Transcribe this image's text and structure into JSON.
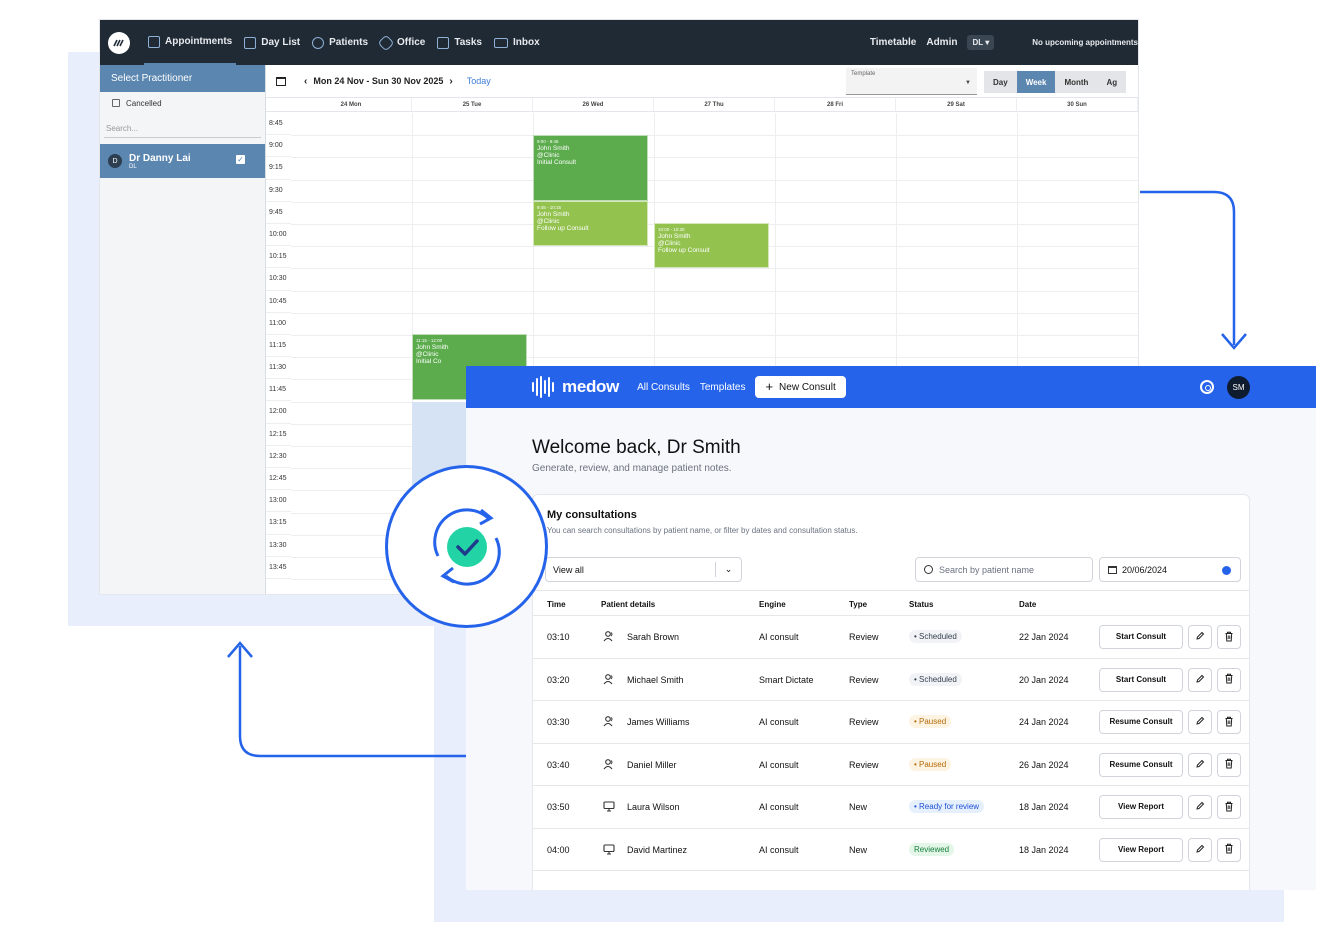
{
  "calendar": {
    "nav": [
      {
        "label": "Appointments",
        "active": true
      },
      {
        "label": "Day List"
      },
      {
        "label": "Patients"
      },
      {
        "label": "Office"
      },
      {
        "label": "Tasks"
      },
      {
        "label": "Inbox"
      }
    ],
    "top_right": {
      "timetable": "Timetable",
      "admin": "Admin",
      "user_badge": "DL ▾",
      "upcoming": "No upcoming appointments"
    },
    "sidebar": {
      "header": "Select Practitioner",
      "cancelled": "Cancelled",
      "search_placeholder": "Search...",
      "practitioner": {
        "avatar": "D",
        "name": "Dr Danny Lai",
        "initials": "DL"
      }
    },
    "header": {
      "range": "Mon 24 Nov - Sun 30 Nov 2025",
      "today": "Today",
      "template_label": "Template",
      "views": [
        "Day",
        "Week",
        "Month",
        "Ag"
      ],
      "active_view": "Week"
    },
    "days": [
      "24 Mon",
      "25 Tue",
      "26 Wed",
      "27 Thu",
      "28 Fri",
      "29 Sat",
      "30 Sun"
    ],
    "times": [
      "8:45",
      "9:00",
      "9:15",
      "9:30",
      "9:45",
      "10:00",
      "10:15",
      "10:30",
      "10:45",
      "11:00",
      "11:15",
      "11:30",
      "11:45",
      "12:00",
      "12:15",
      "12:30",
      "12:45",
      "13:00",
      "13:15",
      "13:30",
      "13:45"
    ],
    "appointments": [
      {
        "time": "9:00 - 9:45",
        "patient": "John Smith",
        "location": "@Clinic",
        "type": "Initial Consult",
        "color": "#5cab4d"
      },
      {
        "time": "9:45 - 10:15",
        "patient": "John Smith",
        "location": "@Clinic",
        "type": "Follow up Consult",
        "color": "#93c24f"
      },
      {
        "time": "10:00 - 10:30",
        "patient": "John Smith",
        "location": "@Clinic",
        "type": "Follow up Consult",
        "color": "#93c24f"
      },
      {
        "time": "11:15 - 12:00",
        "patient": "John Smith",
        "location": "@Clinic",
        "type": "Initial Co",
        "color": "#5cab4d"
      }
    ]
  },
  "medow": {
    "brand": "medow",
    "nav": {
      "all_consults": "All Consults",
      "templates": "Templates",
      "new_consult": "New Consult"
    },
    "avatar": "SM",
    "welcome": "Welcome back, Dr Smith",
    "subtitle": "Generate, review, and manage patient notes.",
    "card": {
      "title": "My consultations",
      "description": "You can search consultations by patient name, or filter by dates and consultation status.",
      "filter_value": "View all",
      "search_placeholder": "Search by patient name",
      "date_value": "20/06/2024"
    },
    "columns": {
      "time": "Time",
      "patient": "Patient details",
      "engine": "Engine",
      "type": "Type",
      "status": "Status",
      "date": "Date"
    },
    "rows": [
      {
        "time": "03:10",
        "patient": "Sarah Brown",
        "engine": "AI consult",
        "type": "Review",
        "status": "• Scheduled",
        "status_kind": "sched",
        "date": "22 Jan 2024",
        "action": "Start Consult",
        "icon": "person"
      },
      {
        "time": "03:20",
        "patient": "Michael Smith",
        "engine": "Smart Dictate",
        "type": "Review",
        "status": "• Scheduled",
        "status_kind": "sched",
        "date": "20 Jan 2024",
        "action": "Start Consult",
        "icon": "person"
      },
      {
        "time": "03:30",
        "patient": "James Williams",
        "engine": "AI consult",
        "type": "Review",
        "status": "• Paused",
        "status_kind": "paused",
        "date": "24 Jan 2024",
        "action": "Resume Consult",
        "icon": "person"
      },
      {
        "time": "03:40",
        "patient": "Daniel Miller",
        "engine": "AI consult",
        "type": "Review",
        "status": "• Paused",
        "status_kind": "paused",
        "date": "26 Jan 2024",
        "action": "Resume Consult",
        "icon": "person"
      },
      {
        "time": "03:50",
        "patient": "Laura Wilson",
        "engine": "AI consult",
        "type": "New",
        "status": "• Ready for review",
        "status_kind": "ready",
        "date": "18 Jan 2024",
        "action": "View Report",
        "icon": "monitor"
      },
      {
        "time": "04:00",
        "patient": "David Martinez",
        "engine": "AI consult",
        "type": "New",
        "status": "Reviewed",
        "status_kind": "reviewed",
        "date": "18 Jan 2024",
        "action": "View Report",
        "icon": "monitor"
      }
    ],
    "colors": {
      "brand_blue": "#2563eb",
      "calendar_nav": "#1f2a35",
      "calendar_accent": "#5b86b0"
    }
  }
}
